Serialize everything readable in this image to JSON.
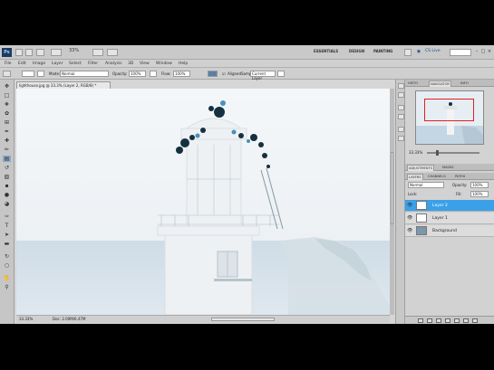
{
  "appbar": {
    "logo": "Ps",
    "zoom": "33%",
    "workspaces": [
      "ESSENTIALS",
      "DESIGN",
      "PAINTING"
    ],
    "cs_live": "CS Live"
  },
  "menu": {
    "items": [
      "File",
      "Edit",
      "Image",
      "Layer",
      "Select",
      "Filter",
      "Analysis",
      "3D",
      "View",
      "Window",
      "Help"
    ]
  },
  "options": {
    "mode_label": "Mode:",
    "mode_value": "Normal",
    "opacity_label": "Opacity:",
    "opacity_value": "100%",
    "flow_label": "Flow:",
    "flow_value": "100%",
    "aligned_label": "Aligned",
    "sample_label": "Sample:",
    "sample_value": "Current Layer"
  },
  "document": {
    "tab_title": "lighthouse.jpg @ 33.3% (Layer 2, RGB/8) *",
    "status_zoom": "33.33%",
    "status_doc": "Doc: 2.00M/6.47M"
  },
  "navigator": {
    "tabs": [
      "HISTO",
      "NAVIGATOR",
      "INFO"
    ],
    "zoom": "33.33%"
  },
  "layers": {
    "tabs": [
      "LAYERS",
      "CHANNELS",
      "PATHS"
    ],
    "blend_mode": "Normal",
    "opacity_label": "Opacity:",
    "opacity_value": "100%",
    "lock_label": "Lock:",
    "fill_label": "Fill:",
    "fill_value": "100%",
    "items": [
      {
        "name": "Layer 2",
        "selected": true
      },
      {
        "name": "Layer 1",
        "selected": false
      },
      {
        "name": "Background",
        "selected": false
      }
    ]
  },
  "adjust": {
    "tabs": [
      "ADJUSTMENTS",
      "MASKS"
    ]
  }
}
